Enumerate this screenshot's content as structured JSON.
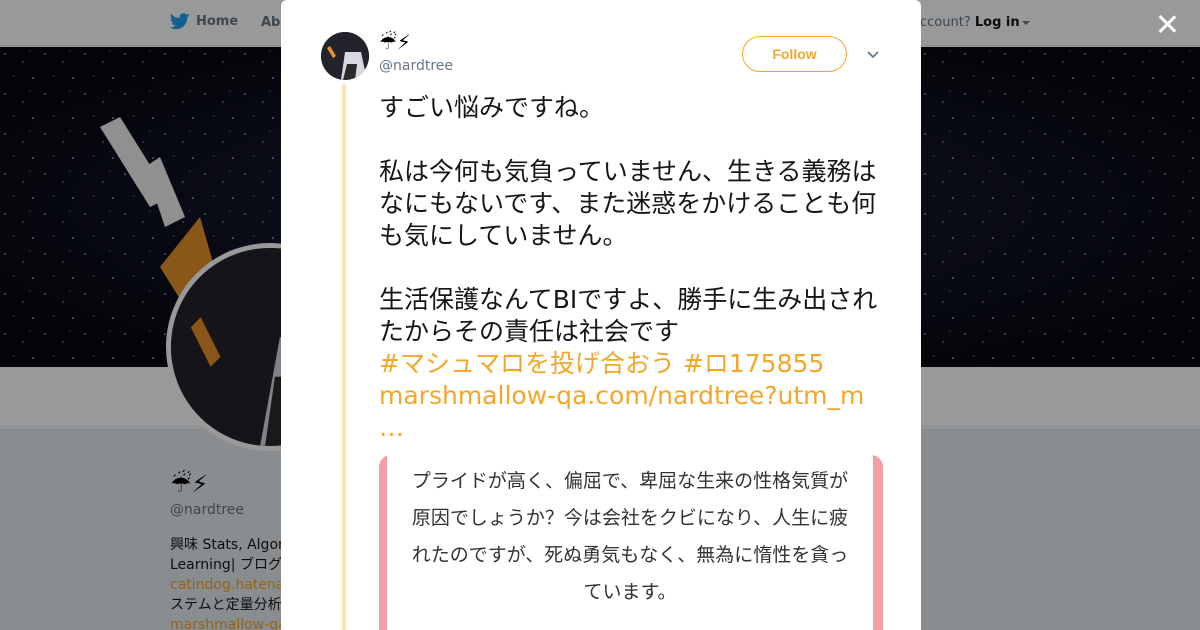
{
  "topnav": {
    "home_label": "Home",
    "about_label": "Abo",
    "account_prompt": "ccount?",
    "login_label": "Log in"
  },
  "profile": {
    "display_name": "☔⚡",
    "handle": "@nardtree",
    "bio_line1": "興味 Stats, Algorit",
    "bio_line2": "Learning| ブログ",
    "bio_link1": "catindog.hatenabl",
    "bio_line3": "ステムと定量分析",
    "bio_link2": "marshmallow-qa.c"
  },
  "modal": {
    "author_name": "☔⚡",
    "author_handle": "@nardtree",
    "follow_label": "Follow",
    "tweet": {
      "para1": "すごい悩みですね。",
      "para2": "私は今何も気負っていません、生きる義務はなにもないです、また迷惑をかけることも何も気にしていません。",
      "para3": "生活保護なんてBIですよ、勝手に生み出されたからその責任は社会です",
      "hashtag1": "#マシュマロを投げ合おう",
      "hashtag2": "#ロ175855",
      "link_text": "marshmallow-qa.com/nardtree?utm_m …"
    },
    "card": {
      "text": "プライドが高く、偏屈で、卑屈な生来の性格気質が原因でしょうか？今は会社をクビになり、人生に疲れたのですが、死ぬ勇気もなく、無為に惰性を貪っています。"
    }
  },
  "colors": {
    "accent": "#f4a62a",
    "card_border": "#f2a0a4",
    "thread_line": "#fde7b4"
  },
  "icons": [
    "twitter-bird-icon",
    "close-icon",
    "chevron-down-icon",
    "caret-down-icon"
  ]
}
